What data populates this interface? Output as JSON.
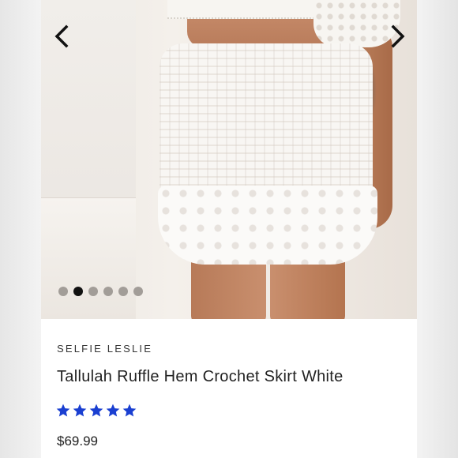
{
  "product": {
    "brand": "SELFIE LESLIE",
    "title": "Tallulah Ruffle Hem Crochet Skirt White",
    "rating_stars": 5,
    "rating_max": 5,
    "price": "$69.99"
  },
  "gallery": {
    "image_count": 6,
    "active_index": 1,
    "prev_icon": "chevron-left-icon",
    "next_icon": "chevron-right-icon"
  },
  "colors": {
    "star": "#1a3fd1",
    "dot_active": "#111111",
    "dot_inactive": "#a29d98"
  }
}
